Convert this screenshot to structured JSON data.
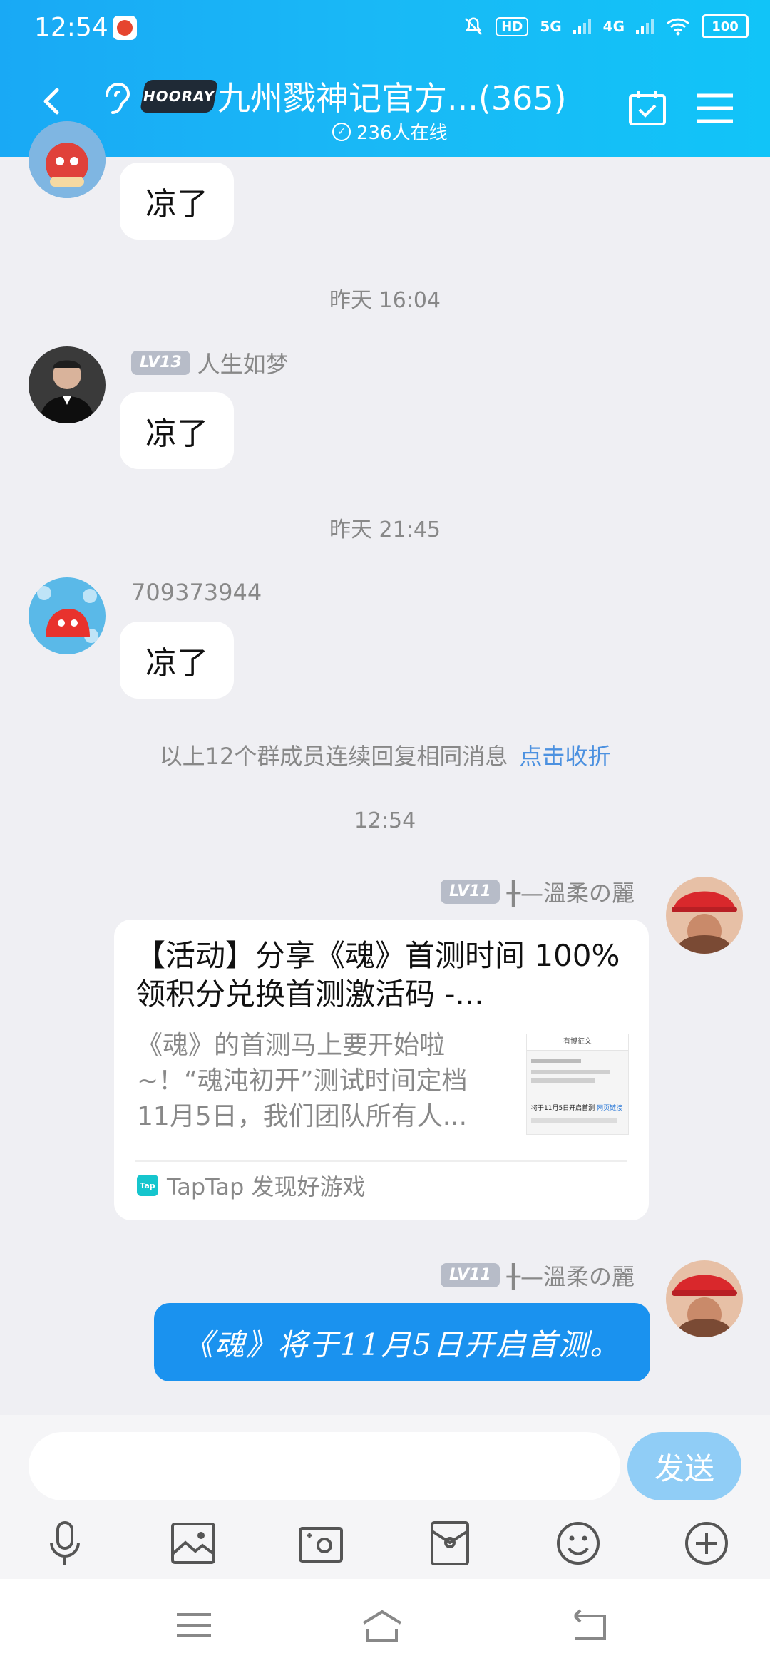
{
  "status_bar": {
    "time": "12:54",
    "hd": "HD",
    "net1": "5G",
    "net2": "4G",
    "battery": "100"
  },
  "header": {
    "logo_text": "HOORAY",
    "title": "九州戮神记官方...(365)",
    "online": "236人在线"
  },
  "messages": [
    {
      "text": "凉了"
    },
    {
      "timestamp": "昨天 16:04",
      "level": "LV13",
      "sender": "人生如梦",
      "text": "凉了"
    },
    {
      "timestamp": "昨天 21:45",
      "sender": "709373944",
      "text": "凉了"
    }
  ],
  "collapse": {
    "text": "以上12个群成员连续回复相同消息",
    "link": "点击收折"
  },
  "timestamp_2": "12:54",
  "my_level": "LV11",
  "my_name": "╂—溫柔の麗",
  "card": {
    "title": "【活动】分享《魂》首测时间 100%领积分兑换首测激活码 -...",
    "desc": "《魂》的首测马上要开始啦~！“魂沌初开”测试时间定档11月5日，我们团队所有人...",
    "thumb_title": "有博征文",
    "thumb_link_prefix": "将于11月5日开启首测",
    "thumb_link": "网页链接",
    "source_icon": "Tap",
    "source": "TapTap 发现好游戏"
  },
  "my_message": "《魂》将于11月5日开启首测。",
  "input": {
    "send": "发送"
  },
  "colors": {
    "header": "#19b0f5",
    "bubble_blue": "#1a92ef",
    "send": "#90cdf6",
    "link": "#4c91e0"
  }
}
